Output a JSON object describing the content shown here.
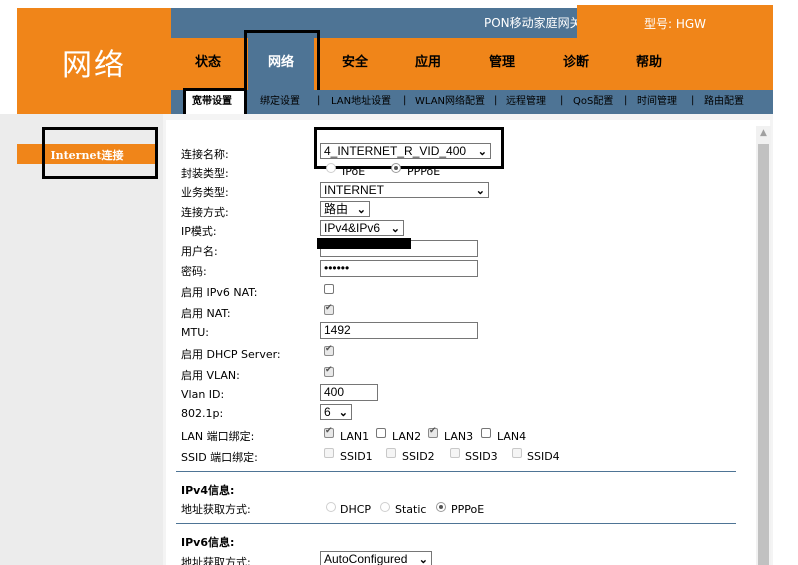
{
  "header": {
    "brand_title": "网络",
    "gateway_label": "PON移动家庭网关",
    "model_label": "型号: HGW"
  },
  "main_nav": [
    "状态",
    "网络",
    "安全",
    "应用",
    "管理",
    "诊断",
    "帮助"
  ],
  "sub_nav": [
    "宽带设置",
    "绑定设置",
    "LAN地址设置",
    "WLAN网络配置",
    "远程管理",
    "QoS配置",
    "时间管理",
    "路由配置"
  ],
  "sidebar": {
    "item": "Internet连接"
  },
  "form": {
    "conn_name_label": "连接名称:",
    "conn_name_value": "4_INTERNET_R_VID_400",
    "encap_label": "封装类型:",
    "encap_ipoe": "IPoE",
    "encap_pppoe": "PPPoE",
    "service_label": "业务类型:",
    "service_value": "INTERNET",
    "conn_mode_label": "连接方式:",
    "conn_mode_value": "路由",
    "ip_mode_label": "IP模式:",
    "ip_mode_value": "IPv4&IPv6",
    "username_label": "用户名:",
    "password_label": "密码:",
    "password_value": "••••••",
    "ipv6nat_label": "启用 IPv6 NAT:",
    "nat_label": "启用 NAT:",
    "mtu_label": "MTU:",
    "mtu_value": "1492",
    "dhcp_label": "启用 DHCP Server:",
    "vlan_label": "启用 VLAN:",
    "vlanid_label": "Vlan ID:",
    "vlanid_value": "400",
    "dot1p_label": "802.1p:",
    "dot1p_value": "6",
    "lan_bind_label": "LAN 端口绑定:",
    "lan_ports": [
      "LAN1",
      "LAN2",
      "LAN3",
      "LAN4"
    ],
    "ssid_bind_label": "SSID 端口绑定:",
    "ssids": [
      "SSID1",
      "SSID2",
      "SSID3",
      "SSID4"
    ],
    "ipv4_section": "IPv4信息:",
    "ipv4_addr_label": "地址获取方式:",
    "ipv4_opts": [
      "DHCP",
      "Static",
      "PPPoE"
    ],
    "ipv6_section": "IPv6信息:",
    "ipv6_addr_label": "地址获取方式:",
    "ipv6_addr_value": "AutoConfigured"
  },
  "colors": {
    "orange": "#f08519",
    "steel_blue": "#4e7495"
  }
}
